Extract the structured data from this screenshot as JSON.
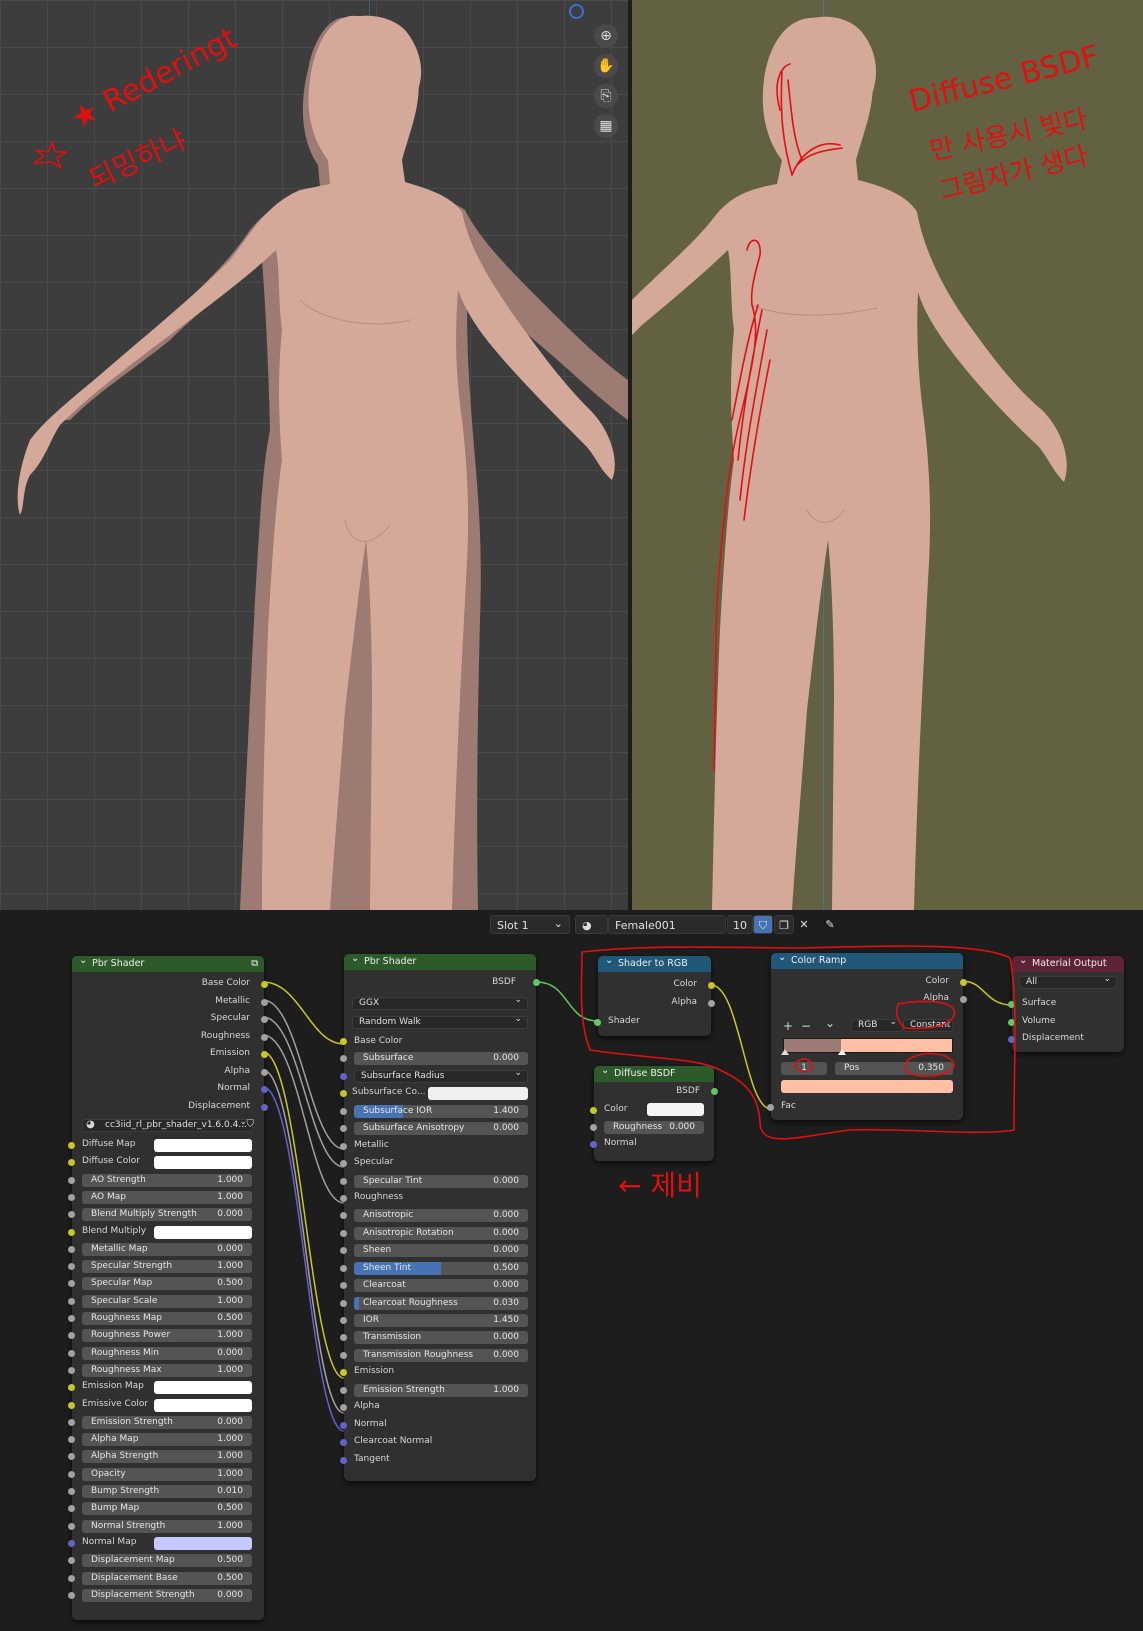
{
  "header": {
    "slot_label": "Slot 1",
    "material_name": "Female001",
    "user_count": "10"
  },
  "annotations": {
    "left_line1": "★ Rederingt",
    "left_line2": "되밍하냐",
    "right_line1": "Diffuse BSDF",
    "right_line2": "만 사용시 빛다",
    "right_line3": "그림자가 생다",
    "node_note": "← 제비"
  },
  "pbr_left": {
    "title": "Pbr Shader",
    "outputs": [
      "Base Color",
      "Metallic",
      "Specular",
      "Roughness",
      "Emission",
      "Alpha",
      "Normal",
      "Displacement"
    ],
    "group_name": "cc3iid_rl_pbr_shader_v1.6.0.4...",
    "inputs": [
      {
        "label": "Diffuse Map",
        "type": "color",
        "color": "#ffffff"
      },
      {
        "label": "Diffuse Color",
        "type": "color",
        "color": "#ffffff"
      },
      {
        "label": "AO Strength",
        "value": "1.000"
      },
      {
        "label": "AO Map",
        "value": "1.000"
      },
      {
        "label": "Blend Multiply Strength",
        "value": "0.000"
      },
      {
        "label": "Blend Multiply",
        "type": "color",
        "color": "#ffffff"
      },
      {
        "label": "Metallic Map",
        "value": "0.000"
      },
      {
        "label": "Specular Strength",
        "value": "1.000"
      },
      {
        "label": "Specular Map",
        "value": "0.500"
      },
      {
        "label": "Specular Scale",
        "value": "1.000"
      },
      {
        "label": "Roughness Map",
        "value": "0.500"
      },
      {
        "label": "Roughness Power",
        "value": "1.000"
      },
      {
        "label": "Roughness Min",
        "value": "0.000"
      },
      {
        "label": "Roughness Max",
        "value": "1.000"
      },
      {
        "label": "Emission Map",
        "type": "color",
        "color": "#ffffff"
      },
      {
        "label": "Emissive Color",
        "type": "color",
        "color": "#ffffff"
      },
      {
        "label": "Emission Strength",
        "value": "0.000"
      },
      {
        "label": "Alpha Map",
        "value": "1.000"
      },
      {
        "label": "Alpha Strength",
        "value": "1.000"
      },
      {
        "label": "Opacity",
        "value": "1.000"
      },
      {
        "label": "Bump Strength",
        "value": "0.010"
      },
      {
        "label": "Bump Map",
        "value": "0.500"
      },
      {
        "label": "Normal Strength",
        "value": "1.000"
      },
      {
        "label": "Normal Map",
        "type": "color",
        "color": "#c4c8ff"
      },
      {
        "label": "Displacement Map",
        "value": "0.500"
      },
      {
        "label": "Displacement Base",
        "value": "0.500"
      },
      {
        "label": "Displacement Strength",
        "value": "0.000"
      }
    ]
  },
  "pbr_mid": {
    "title": "Pbr Shader",
    "output": "BSDF",
    "distribution": "GGX",
    "subsurface_method": "Random Walk",
    "base_color": "Base Color",
    "subsurface": {
      "label": "Subsurface",
      "value": "0.000"
    },
    "subsurface_radius": "Subsurface Radius",
    "subsurface_color": "Subsurface Co...",
    "subsurface_ior": {
      "label": "Subsurface IOR",
      "value": "1.400"
    },
    "subsurface_aniso": {
      "label": "Subsurface Anisotropy",
      "value": "0.000"
    },
    "metallic": "Metallic",
    "specular": "Specular",
    "specular_tint": {
      "label": "Specular Tint",
      "value": "0.000"
    },
    "roughness": "Roughness",
    "anisotropic": {
      "label": "Anisotropic",
      "value": "0.000"
    },
    "anisotropic_rotation": {
      "label": "Anisotropic Rotation",
      "value": "0.000"
    },
    "sheen": {
      "label": "Sheen",
      "value": "0.000"
    },
    "sheen_tint": {
      "label": "Sheen Tint",
      "value": "0.500"
    },
    "clearcoat": {
      "label": "Clearcoat",
      "value": "0.000"
    },
    "clearcoat_roughness": {
      "label": "Clearcoat Roughness",
      "value": "0.030"
    },
    "ior": {
      "label": "IOR",
      "value": "1.450"
    },
    "transmission": {
      "label": "Transmission",
      "value": "0.000"
    },
    "transmission_roughness": {
      "label": "Transmission Roughness",
      "value": "0.000"
    },
    "emission": "Emission",
    "emission_strength": {
      "label": "Emission Strength",
      "value": "1.000"
    },
    "alpha": "Alpha",
    "normal": "Normal",
    "clearcoat_normal": "Clearcoat Normal",
    "tangent": "Tangent"
  },
  "shader_to_rgb": {
    "title": "Shader to RGB",
    "out_color": "Color",
    "out_alpha": "Alpha",
    "in_shader": "Shader"
  },
  "diffuse_bsdf": {
    "title": "Diffuse BSDF",
    "output": "BSDF",
    "color": "Color",
    "roughness": {
      "label": "Roughness",
      "value": "0.000"
    },
    "normal": "Normal"
  },
  "color_ramp": {
    "title": "Color Ramp",
    "out_color": "Color",
    "out_alpha": "Alpha",
    "add": "+",
    "remove": "−",
    "menu": "⌄",
    "mode": "RGB",
    "interpolation": "Constant",
    "stop_index": "1",
    "pos_label": "Pos",
    "pos_value": "0.350",
    "stop_color": "#ffc0a6",
    "left_color": "#9d7a72",
    "fac": "Fac"
  },
  "material_output": {
    "title": "Material Output",
    "target": "All",
    "surface": "Surface",
    "volume": "Volume",
    "displacement": "Displacement"
  },
  "colors": {
    "skin": "#d4a99a",
    "skin_shadow": "#9d7a72",
    "viewport_bg": "#3d3d3d",
    "viewport_olive": "#626242",
    "ink": "#e01010"
  }
}
